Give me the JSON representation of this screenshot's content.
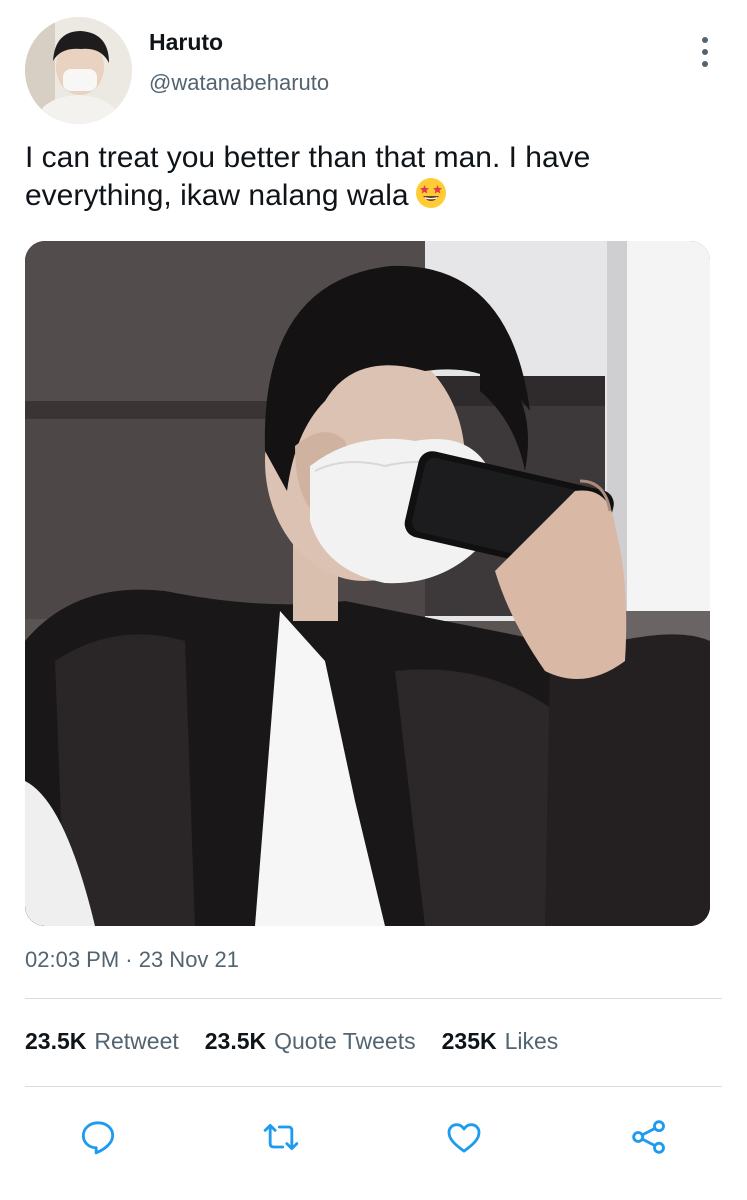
{
  "user": {
    "display_name": "Haruto",
    "handle": "@watanabeharuto"
  },
  "tweet": {
    "text": "I can treat you better than that man. I have everything, ikaw nalang wala",
    "emoji": "star-struck-emoji",
    "timestamp": "02:03 PM · 23 Nov 21"
  },
  "stats": {
    "retweets_count": "23.5K",
    "retweets_label": "Retweet",
    "quotes_count": "23.5K",
    "quotes_label": "Quote Tweets",
    "likes_count": "235K",
    "likes_label": "Likes"
  },
  "actions": [
    "reply-icon",
    "retweet-icon",
    "like-icon",
    "share-icon"
  ],
  "colors": {
    "text_primary": "#0f1419",
    "text_secondary": "#536471",
    "divider": "#d9dde0",
    "icon": "#1d9bf0"
  }
}
